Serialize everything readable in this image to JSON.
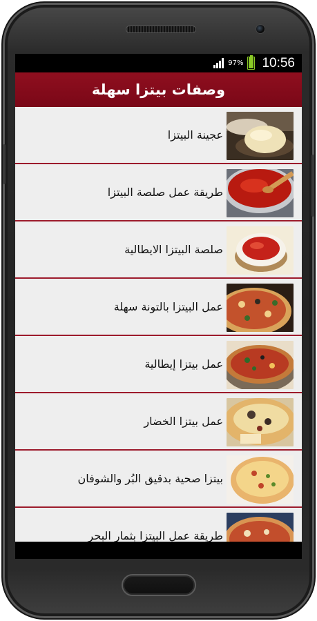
{
  "status_bar": {
    "battery_percent_text": "97%",
    "battery_level": 0.97,
    "time": "10:56",
    "signal_icon": "signal-bars-icon",
    "battery_icon": "battery-icon"
  },
  "app_bar": {
    "title": "وصفات بيتزا سهلة"
  },
  "recipes": [
    {
      "label": "عجينة البيتزا",
      "thumb": "pizza-dough-photo"
    },
    {
      "label": "طريقة عمل صلصة البيتزا",
      "thumb": "sauce-pot-photo"
    },
    {
      "label": "صلصة البيتزا الايطالية",
      "thumb": "sauce-bowl-photo"
    },
    {
      "label": "عمل البيتزا بالتونة سهلة",
      "thumb": "tuna-pizza-photo"
    },
    {
      "label": "عمل بيتزا إيطالية",
      "thumb": "italian-pizza-photo"
    },
    {
      "label": "عمل بيتزا الخضار",
      "thumb": "vegetable-pizza-photo"
    },
    {
      "label": "بيتزا صحية بدقيق البُر والشوفان",
      "thumb": "healthy-pizza-photo"
    },
    {
      "label": "طريقة عمل البيتزا بثمار البحر",
      "thumb": "seafood-pizza-photo"
    }
  ],
  "colors": {
    "accent": "#8b0d1e",
    "divider": "#9c1a2b",
    "list_background": "#eeeeee",
    "battery": "#8ac926"
  }
}
